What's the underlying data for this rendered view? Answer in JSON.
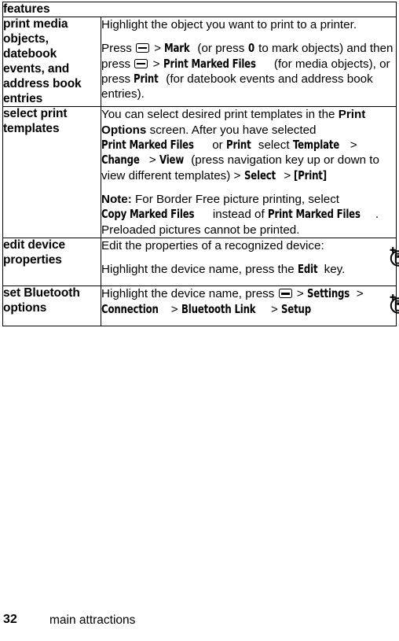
{
  "page": {
    "number": "32",
    "running_footer": "main attractions"
  },
  "table": {
    "header": "features",
    "rows": [
      {
        "term": "print media objects, datebook events, and address book entries",
        "paragraphs": [
          {
            "id": "p1",
            "segments": [
              {
                "type": "text",
                "value": "Highlight the object you want to print to a printer."
              }
            ]
          },
          {
            "id": "p2",
            "segments": [
              {
                "type": "text",
                "value": "Press "
              },
              {
                "type": "menukey"
              },
              {
                "type": "sep",
                "value": " > "
              },
              {
                "type": "ui",
                "value": "Mark"
              },
              {
                "type": "text",
                "value": " (or press "
              },
              {
                "type": "ui",
                "value": "0"
              },
              {
                "type": "text",
                "value": " to mark objects) and then press "
              },
              {
                "type": "menukey"
              },
              {
                "type": "sep",
                "value": " > "
              },
              {
                "type": "ui",
                "value": "Print Marked Files"
              },
              {
                "type": "text",
                "value": " (for media objects), or press "
              },
              {
                "type": "ui",
                "value": "Print"
              },
              {
                "type": "text",
                "value": " (for datebook events and address book entries)."
              }
            ]
          }
        ],
        "icon": null
      },
      {
        "term": "select print templates",
        "paragraphs": [
          {
            "id": "p1",
            "segments": [
              {
                "type": "text",
                "value": "You can select desired print templates in the "
              },
              {
                "type": "bold",
                "value": "Print Options"
              },
              {
                "type": "text",
                "value": " screen. After you have selected "
              },
              {
                "type": "ui",
                "value": "Print Marked Files"
              },
              {
                "type": "text",
                "value": " or "
              },
              {
                "type": "ui",
                "value": "Print"
              },
              {
                "type": "text",
                "value": " select "
              },
              {
                "type": "ui",
                "value": "Template"
              },
              {
                "type": "sep",
                "value": " > "
              },
              {
                "type": "ui",
                "value": "Change"
              },
              {
                "type": "sep",
                "value": " > "
              },
              {
                "type": "ui",
                "value": "View"
              },
              {
                "type": "text",
                "value": " (press navigation key up or down to view different templates)"
              },
              {
                "type": "sep",
                "value": " > "
              },
              {
                "type": "ui",
                "value": "Select"
              },
              {
                "type": "sep",
                "value": " > "
              },
              {
                "type": "ui",
                "value": "[Print]"
              }
            ]
          },
          {
            "id": "p2",
            "segments": [
              {
                "type": "bold",
                "value": "Note:"
              },
              {
                "type": "text",
                "value": " For Border Free picture printing, select "
              },
              {
                "type": "ui",
                "value": "Copy Marked Files"
              },
              {
                "type": "text",
                "value": " instead of "
              },
              {
                "type": "ui",
                "value": "Print Marked Files"
              },
              {
                "type": "text",
                "value": ". Preloaded pictures cannot be printed."
              }
            ]
          }
        ],
        "icon": null
      },
      {
        "term": "edit device properties",
        "paragraphs": [
          {
            "id": "p1",
            "segments": [
              {
                "type": "text",
                "value": "Edit the properties of a recognized device:"
              }
            ]
          },
          {
            "id": "p2",
            "segments": [
              {
                "type": "text",
                "value": "Highlight the device name, press the "
              },
              {
                "type": "ui",
                "value": "Edit"
              },
              {
                "type": "text",
                "value": " key."
              }
            ]
          }
        ],
        "icon": "bluetooth-device-icon"
      },
      {
        "term": "set Bluetooth options",
        "paragraphs": [
          {
            "id": "p1",
            "segments": [
              {
                "type": "text",
                "value": "Highlight the device name, press "
              },
              {
                "type": "menukey"
              },
              {
                "type": "sep",
                "value": " > "
              },
              {
                "type": "ui",
                "value": "Settings"
              },
              {
                "type": "sep",
                "value": "> "
              },
              {
                "type": "ui",
                "value": "Connection"
              },
              {
                "type": "sep",
                "value": " > "
              },
              {
                "type": "ui",
                "value": "Bluetooth Link"
              },
              {
                "type": "sep",
                "value": " > "
              },
              {
                "type": "ui",
                "value": "Setup"
              }
            ]
          }
        ],
        "icon": "bluetooth-device-icon"
      }
    ]
  }
}
